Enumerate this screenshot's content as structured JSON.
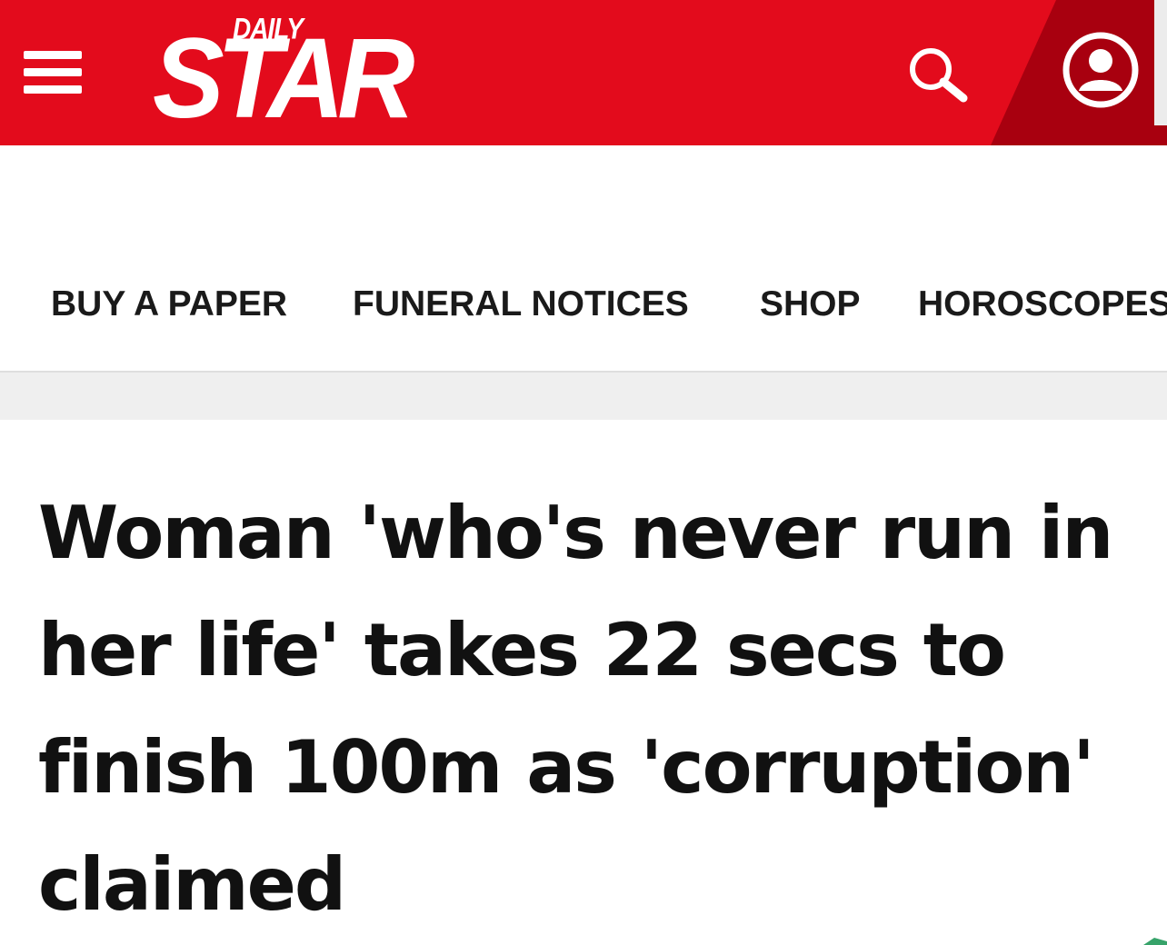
{
  "header": {
    "brand_color": "#e30b1c",
    "logo_top": "DAILY",
    "logo_main": "STAR",
    "menu_icon": "hamburger-menu-icon",
    "search_icon": "search-icon",
    "account_icon": "user-account-icon"
  },
  "nav": {
    "items": [
      {
        "label": "BUY A PAPER"
      },
      {
        "label": "FUNERAL NOTICES"
      },
      {
        "label": "SHOP"
      },
      {
        "label": "HOROSCOPES"
      }
    ]
  },
  "article": {
    "headline": "Woman 'who's never run in her life' takes 22 secs to finish 100m as 'corruption' claimed"
  }
}
